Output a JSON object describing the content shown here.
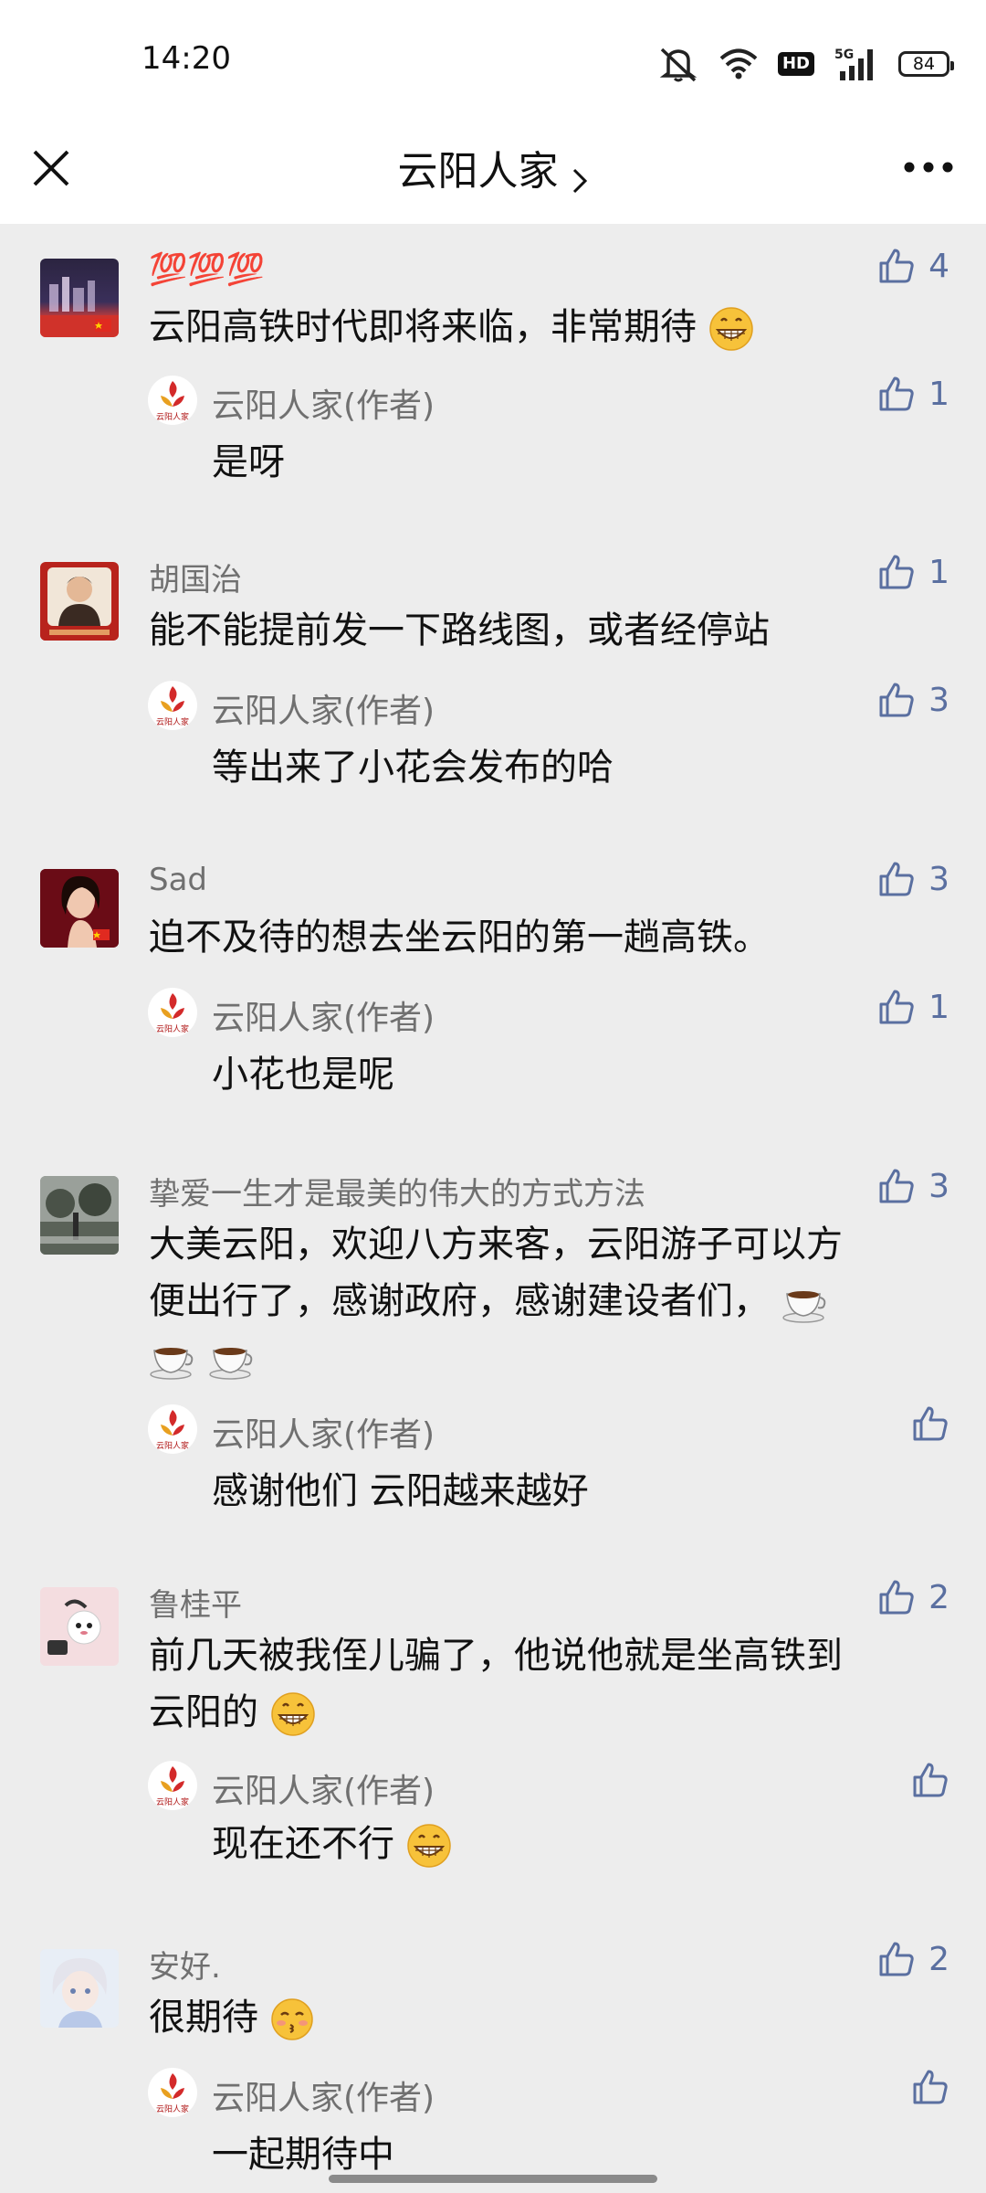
{
  "status_bar": {
    "time": "14:20",
    "network": "5G",
    "hd_badge": "HD",
    "battery": "84",
    "icons": [
      "mute-icon",
      "wifi-icon",
      "hd-icon",
      "signal-icon",
      "battery-icon"
    ]
  },
  "header": {
    "title": "云阳人家",
    "close_icon": "close-icon",
    "chevron_icon": "chevron-right-icon",
    "more_icon": "more-icon"
  },
  "colors": {
    "like_blue": "#5a6fa0",
    "name_gray": "#707070",
    "background": "#ededed"
  },
  "comments": [
    {
      "username": "💯💯💯",
      "text": "云阳高铁时代即将来临，非常期待",
      "text_emoji": "grin",
      "likes": "4",
      "reply": {
        "author": "云阳人家(作者)",
        "text": "是呀",
        "likes": "1"
      }
    },
    {
      "username": "胡国治",
      "text": "能不能提前发一下路线图，或者经停站",
      "likes": "1",
      "reply": {
        "author": "云阳人家(作者)",
        "text": "等出来了小花会发布的哈",
        "likes": "3"
      }
    },
    {
      "username": "Sad",
      "text": "迫不及待的想去坐云阳的第一趟高铁。",
      "likes": "3",
      "reply": {
        "author": "云阳人家(作者)",
        "text": "小花也是呢",
        "likes": "1"
      }
    },
    {
      "username": "挚爱一生才是最美的伟大的方式方法",
      "text_line1": "大美云阳，欢迎八方来客，云阳游子可以方",
      "text_line2": "便出行了，感谢政府，感谢建设者们，",
      "likes": "3",
      "reply": {
        "author": "云阳人家(作者)",
        "text": "感谢他们 云阳越来越好",
        "likes": ""
      }
    },
    {
      "username": "鲁桂平",
      "text_line1": "前几天被我侄儿骗了，他说他就是坐高铁到",
      "text_line2": "云阳的",
      "likes": "2",
      "reply": {
        "author": "云阳人家(作者)",
        "text": "现在还不行",
        "likes": ""
      }
    },
    {
      "username": "安好.",
      "text": "很期待",
      "likes": "2",
      "reply": {
        "author": "云阳人家(作者)",
        "text": "一起期待中",
        "likes": ""
      }
    }
  ]
}
